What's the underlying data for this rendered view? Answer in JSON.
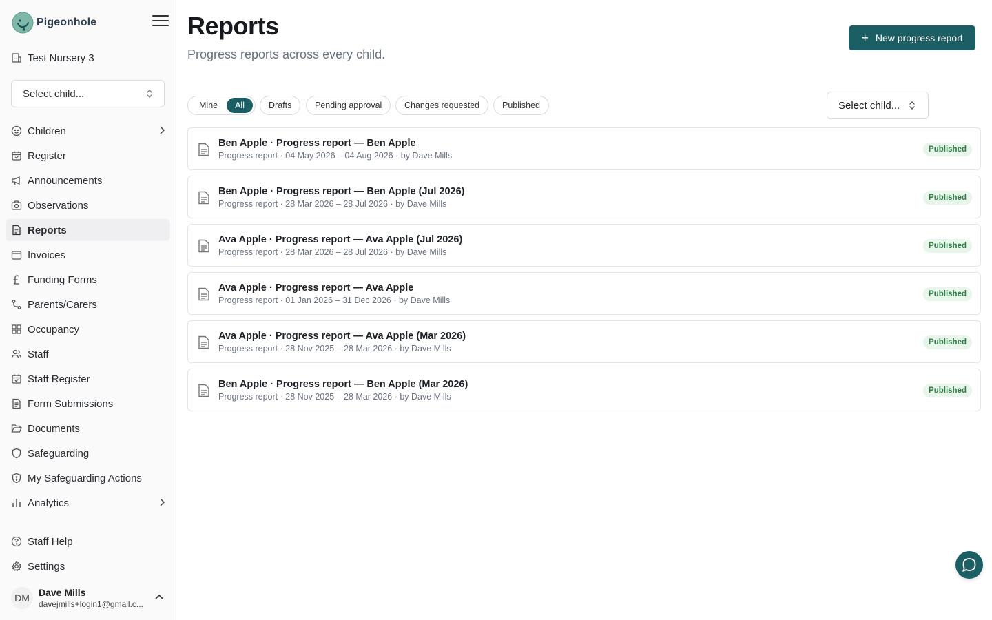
{
  "app": {
    "name": "Pigeonhole",
    "accent": "#1b5e63"
  },
  "sidebar": {
    "nursery": "Test Nursery 3",
    "child_select_placeholder": "Select child...",
    "items": [
      {
        "label": "Children",
        "icon": "baby-face-icon",
        "has_chevron": true
      },
      {
        "label": "Register",
        "icon": "calendar-check-icon"
      },
      {
        "label": "Announcements",
        "icon": "megaphone-icon"
      },
      {
        "label": "Observations",
        "icon": "camera-icon"
      },
      {
        "label": "Reports",
        "icon": "file-text-icon",
        "active": true
      },
      {
        "label": "Invoices",
        "icon": "wallet-icon"
      },
      {
        "label": "Funding Forms",
        "icon": "pound-sign-icon"
      },
      {
        "label": "Parents/Carers",
        "icon": "git-pull-icon"
      },
      {
        "label": "Occupancy",
        "icon": "grid-icon"
      },
      {
        "label": "Staff",
        "icon": "users-icon"
      },
      {
        "label": "Staff Register",
        "icon": "calendar-check-icon"
      },
      {
        "label": "Form Submissions",
        "icon": "file-text-icon"
      },
      {
        "label": "Documents",
        "icon": "folder-open-icon"
      },
      {
        "label": "Safeguarding",
        "icon": "shield-icon"
      },
      {
        "label": "My Safeguarding Actions",
        "icon": "shield-alert-icon"
      },
      {
        "label": "Analytics",
        "icon": "bar-chart-icon",
        "has_chevron": true
      }
    ],
    "bottom_items": [
      {
        "label": "Staff Help",
        "icon": "help-circle-icon"
      },
      {
        "label": "Settings",
        "icon": "gear-icon"
      }
    ],
    "user": {
      "initials": "DM",
      "name": "Dave Mills",
      "email": "davejmills+login1@gmail.c..."
    }
  },
  "main": {
    "title": "Reports",
    "subtitle": "Progress reports across every child.",
    "new_button": "New progress report",
    "filters": {
      "scope": [
        "Mine",
        "All"
      ],
      "scope_selected": "All",
      "status": [
        "Drafts",
        "Pending approval",
        "Changes requested",
        "Published"
      ]
    },
    "child_select_placeholder": "Select child...",
    "reports": [
      {
        "title": "Ben Apple · Progress report — Ben Apple",
        "subtitle": "Progress report · 04 May 2026 – 04 Aug 2026 · by Dave Mills",
        "status": "Published"
      },
      {
        "title": "Ben Apple · Progress report — Ben Apple (Jul 2026)",
        "subtitle": "Progress report · 28 Mar 2026 – 28 Jul 2026 · by Dave Mills",
        "status": "Published"
      },
      {
        "title": "Ava Apple · Progress report — Ava Apple (Jul 2026)",
        "subtitle": "Progress report · 28 Mar 2026 – 28 Jul 2026 · by Dave Mills",
        "status": "Published"
      },
      {
        "title": "Ava Apple · Progress report — Ava Apple",
        "subtitle": "Progress report · 01 Jan 2026 – 31 Dec 2026 · by Dave Mills",
        "status": "Published"
      },
      {
        "title": "Ava Apple · Progress report — Ava Apple (Mar 2026)",
        "subtitle": "Progress report · 28 Nov 2025 – 28 Mar 2026 · by Dave Mills",
        "status": "Published"
      },
      {
        "title": "Ben Apple · Progress report — Ben Apple (Mar 2026)",
        "subtitle": "Progress report · 28 Nov 2025 – 28 Mar 2026 · by Dave Mills",
        "status": "Published"
      }
    ]
  }
}
